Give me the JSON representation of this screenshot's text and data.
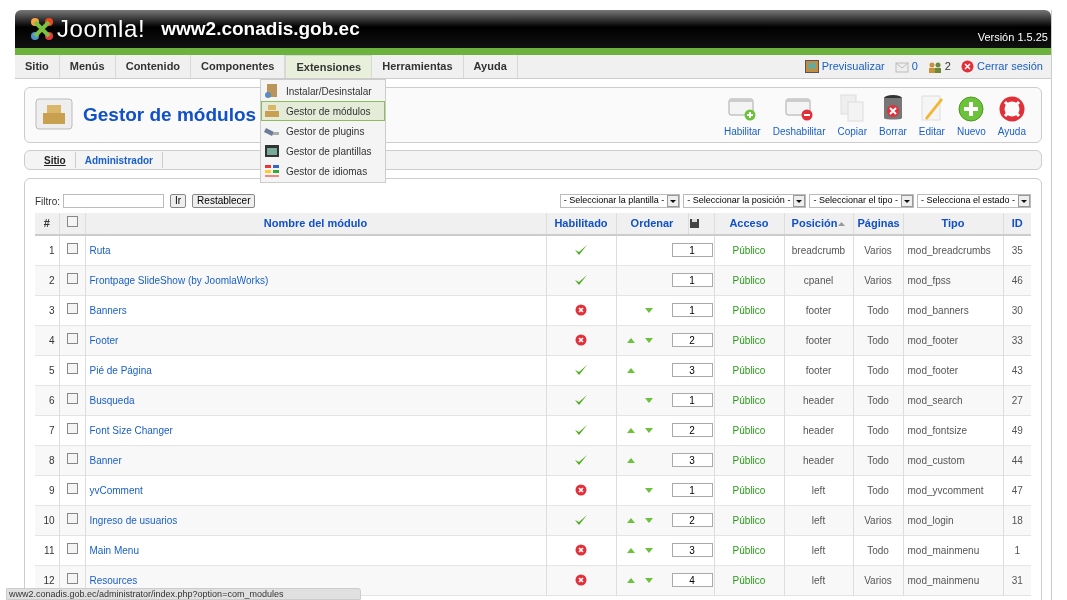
{
  "header": {
    "logo": "Joomla!",
    "site": "www2.conadis.gob.ec",
    "version": "Versión 1.5.25"
  },
  "menu": [
    {
      "label": "Sitio",
      "selected": false
    },
    {
      "label": "Menús",
      "selected": false
    },
    {
      "label": "Contenido",
      "selected": false
    },
    {
      "label": "Componentes",
      "selected": false
    },
    {
      "label": "Extensiones",
      "selected": true
    },
    {
      "label": "Herramientas",
      "selected": false
    },
    {
      "label": "Ayuda",
      "selected": false
    }
  ],
  "status_links": [
    {
      "kind": "preview",
      "label": "Previsualizar"
    },
    {
      "kind": "messages",
      "label": "0"
    },
    {
      "kind": "users",
      "label": "2"
    },
    {
      "kind": "logout",
      "label": "Cerrar sesión"
    }
  ],
  "dropdown": [
    {
      "kind": "install",
      "label": "Instalar/Desinstalar",
      "selected": false
    },
    {
      "kind": "modules",
      "label": "Gestor de módulos",
      "selected": true
    },
    {
      "kind": "plugins",
      "label": "Gestor de plugins",
      "selected": false
    },
    {
      "kind": "templates",
      "label": "Gestor de plantillas",
      "selected": false
    },
    {
      "kind": "languages",
      "label": "Gestor de idiomas",
      "selected": false
    }
  ],
  "page_title": "Gestor de módulos",
  "toolbar": [
    {
      "kind": "enable",
      "label": "Habilitar"
    },
    {
      "kind": "disable",
      "label": "Deshabilitar"
    },
    {
      "kind": "copy",
      "label": "Copiar"
    },
    {
      "kind": "delete",
      "label": "Borrar"
    },
    {
      "kind": "edit",
      "label": "Editar"
    },
    {
      "kind": "new",
      "label": "Nuevo"
    },
    {
      "kind": "help",
      "label": "Ayuda"
    }
  ],
  "subtabs": [
    {
      "label": "Sitio",
      "selected": true
    },
    {
      "label": "Administrador",
      "selected": false
    }
  ],
  "filter": {
    "label": "Filtro:",
    "go": "Ir",
    "reset": "Restablecer"
  },
  "selects": [
    "- Seleccionar la plantilla -",
    "- Seleccionar la posición -",
    "- Seleccionar el tipo -",
    "- Selecciona el estado -"
  ],
  "table": {
    "header_checked": false,
    "columns": [
      {
        "label": "#",
        "sorted": false
      },
      {
        "label": "Nombre del módulo",
        "sorted": false
      },
      {
        "label": "Habilitado",
        "sorted": false
      },
      {
        "label": "Ordenar",
        "sorted": false
      },
      {
        "label": "Acceso",
        "sorted": false
      },
      {
        "label": "Posición",
        "sorted": true
      },
      {
        "label": "Páginas",
        "sorted": false
      },
      {
        "label": "Tipo",
        "sorted": false
      },
      {
        "label": "ID",
        "sorted": false
      }
    ],
    "rows": [
      {
        "num": "1",
        "checked": false,
        "name": "Ruta",
        "enabled": true,
        "up": false,
        "down": false,
        "order": "1",
        "access": "Público",
        "position": "breadcrumb",
        "pages": "Varios",
        "type": "mod_breadcrumbs",
        "id": "35"
      },
      {
        "num": "2",
        "checked": false,
        "name": "Frontpage SlideShow (by JoomlaWorks)",
        "enabled": true,
        "up": false,
        "down": false,
        "order": "1",
        "access": "Público",
        "position": "cpanel",
        "pages": "Varios",
        "type": "mod_fpss",
        "id": "46"
      },
      {
        "num": "3",
        "checked": false,
        "name": "Banners",
        "enabled": false,
        "up": false,
        "down": true,
        "order": "1",
        "access": "Público",
        "position": "footer",
        "pages": "Todo",
        "type": "mod_banners",
        "id": "30"
      },
      {
        "num": "4",
        "checked": false,
        "name": "Footer",
        "enabled": false,
        "up": true,
        "down": true,
        "order": "2",
        "access": "Público",
        "position": "footer",
        "pages": "Todo",
        "type": "mod_footer",
        "id": "33"
      },
      {
        "num": "5",
        "checked": false,
        "name": "Pié de Página",
        "enabled": true,
        "up": true,
        "down": false,
        "order": "3",
        "access": "Público",
        "position": "footer",
        "pages": "Todo",
        "type": "mod_footer",
        "id": "43"
      },
      {
        "num": "6",
        "checked": false,
        "name": "Busqueda",
        "enabled": true,
        "up": false,
        "down": true,
        "order": "1",
        "access": "Público",
        "position": "header",
        "pages": "Todo",
        "type": "mod_search",
        "id": "27"
      },
      {
        "num": "7",
        "checked": false,
        "name": "Font Size Changer",
        "enabled": true,
        "up": true,
        "down": true,
        "order": "2",
        "access": "Público",
        "position": "header",
        "pages": "Todo",
        "type": "mod_fontsize",
        "id": "49"
      },
      {
        "num": "8",
        "checked": false,
        "name": "Banner",
        "enabled": true,
        "up": true,
        "down": false,
        "order": "3",
        "access": "Público",
        "position": "header",
        "pages": "Todo",
        "type": "mod_custom",
        "id": "44"
      },
      {
        "num": "9",
        "checked": false,
        "name": "yvComment",
        "enabled": false,
        "up": false,
        "down": true,
        "order": "1",
        "access": "Público",
        "position": "left",
        "pages": "Todo",
        "type": "mod_yvcomment",
        "id": "47"
      },
      {
        "num": "10",
        "checked": false,
        "name": "Ingreso de usuarios",
        "enabled": true,
        "up": true,
        "down": true,
        "order": "2",
        "access": "Público",
        "position": "left",
        "pages": "Varios",
        "type": "mod_login",
        "id": "18"
      },
      {
        "num": "11",
        "checked": false,
        "name": "Main Menu",
        "enabled": false,
        "up": true,
        "down": true,
        "order": "3",
        "access": "Público",
        "position": "left",
        "pages": "Todo",
        "type": "mod_mainmenu",
        "id": "1"
      },
      {
        "num": "12",
        "checked": false,
        "name": "Resources",
        "enabled": false,
        "up": true,
        "down": true,
        "order": "4",
        "access": "Público",
        "position": "left",
        "pages": "Varios",
        "type": "mod_mainmenu",
        "id": "31"
      }
    ]
  },
  "status_bar": "www2.conadis.gob.ec/administrator/index.php?option=com_modules"
}
